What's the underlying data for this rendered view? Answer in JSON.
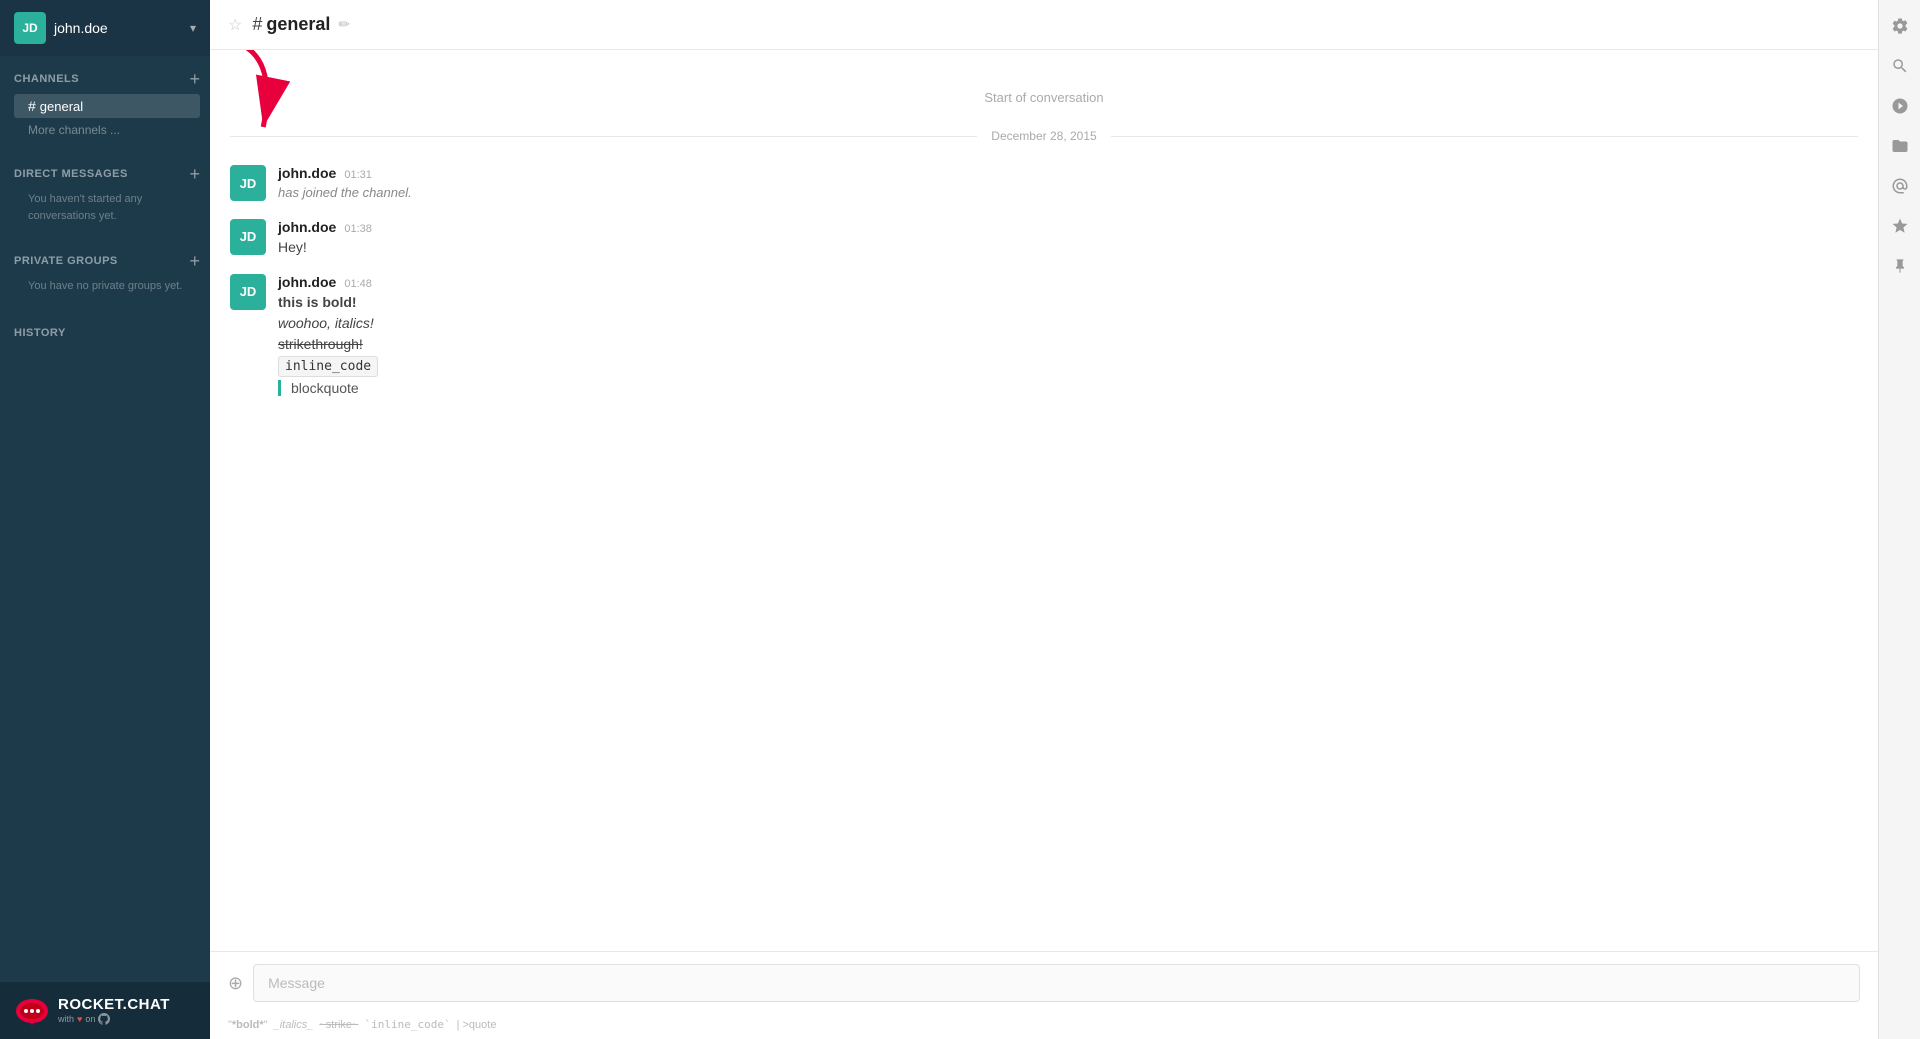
{
  "user": {
    "initials": "JD",
    "name": "john.doe"
  },
  "sidebar": {
    "channels_label": "CHANNELS",
    "channels": [
      {
        "name": "general",
        "active": true
      }
    ],
    "more_channels": "More channels ...",
    "direct_messages_label": "DIRECT MESSAGES",
    "direct_messages_empty": "You haven't started any conversations yet.",
    "private_groups_label": "PRIVATE GROUPS",
    "private_groups_empty": "You have no private groups yet.",
    "history_label": "HISTORY"
  },
  "branding": {
    "name": "ROCKET.CHAT",
    "sub": "with",
    "sub2": "on"
  },
  "chat": {
    "channel_name": "general",
    "start_of_conversation": "Start of conversation",
    "date_divider": "December 28, 2015",
    "messages": [
      {
        "author": "john.doe",
        "time": "01:31",
        "initials": "JD",
        "text_joined": "has joined the channel."
      },
      {
        "author": "john.doe",
        "time": "01:38",
        "initials": "JD",
        "text": "Hey!"
      },
      {
        "author": "john.doe",
        "time": "01:48",
        "initials": "JD",
        "text_bold": "this is bold!",
        "text_italic": "woohoo, italics!",
        "text_strike": "strikethrough!",
        "text_code": "inline_code",
        "text_blockquote": "blockquote"
      }
    ],
    "input_placeholder": "Message"
  },
  "right_icons": {
    "gear": "⚙",
    "search": "🔍",
    "at": "@",
    "folder": "📁",
    "mention": "◎",
    "star": "★",
    "pin": "📌"
  },
  "format_hints": {
    "bold": "*bold*",
    "italics": "_italics_",
    "strike": "~strike~",
    "code": "`inline_code`",
    "quote": ">quote"
  }
}
